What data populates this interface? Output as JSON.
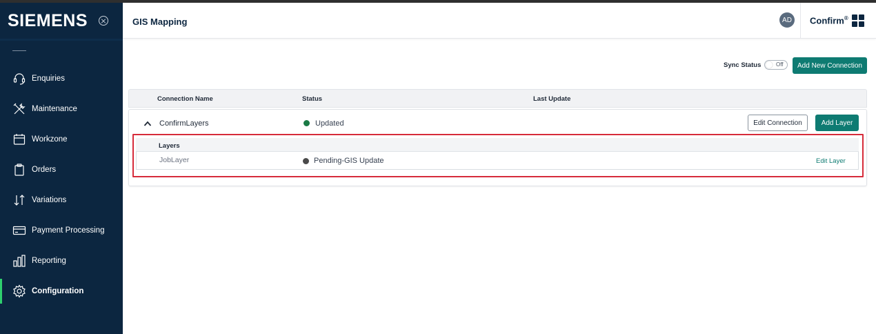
{
  "brand": {
    "logo_text": "SIEMENS"
  },
  "sidebar": {
    "items": [
      {
        "label": "Enquiries",
        "icon": "headset-icon"
      },
      {
        "label": "Maintenance",
        "icon": "tools-icon"
      },
      {
        "label": "Workzone",
        "icon": "calendar-icon"
      },
      {
        "label": "Orders",
        "icon": "clipboard-icon"
      },
      {
        "label": "Variations",
        "icon": "arrows-updown-icon"
      },
      {
        "label": "Payment Processing",
        "icon": "card-icon"
      },
      {
        "label": "Reporting",
        "icon": "bar-chart-icon"
      },
      {
        "label": "Configuration",
        "icon": "gear-icon",
        "active": true
      }
    ]
  },
  "header": {
    "title": "GIS Mapping",
    "avatar_initials": "AD",
    "product_name": "Confirm",
    "product_mark": "®"
  },
  "toolbar": {
    "sync_label": "Sync Status",
    "sync_toggle_state": "Off",
    "add_connection_label": "Add New Connection"
  },
  "table": {
    "columns": [
      "Connection Name",
      "Status",
      "Last Update"
    ]
  },
  "connection": {
    "name": "ConfirmLayers",
    "status": "Updated",
    "edit_label": "Edit Connection",
    "add_layer_label": "Add Layer"
  },
  "layers": {
    "title": "Layers",
    "rows": [
      {
        "name": "JobLayer",
        "status": "Pending-GIS Update",
        "action": "Edit Layer"
      }
    ]
  },
  "colors": {
    "sidebar_bg": "#0c2640",
    "accent": "#0e7b72",
    "status_updated": "#1a7a45",
    "status_pending": "#4a4a4a",
    "highlight": "#d62b3a",
    "active_indicator": "#2ed06e"
  }
}
